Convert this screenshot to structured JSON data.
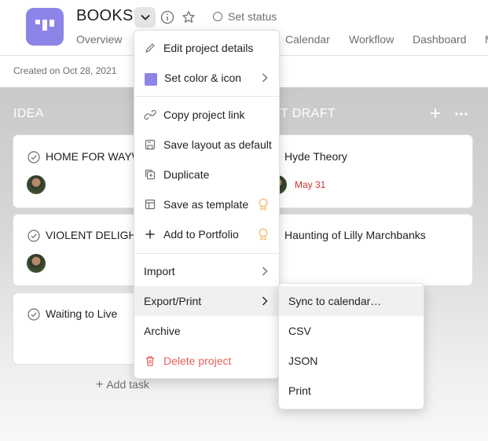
{
  "header": {
    "title": "BOOKS",
    "set_status": "Set status",
    "tabs": [
      "Overview",
      "Calendar",
      "Workflow",
      "Dashboard",
      "M"
    ],
    "created": "Created on Oct 28, 2021",
    "project_color": "#8d84e8"
  },
  "board": {
    "columns": [
      {
        "title": "IDEA"
      },
      {
        "title": "T DRAFT"
      }
    ],
    "cards": [
      {
        "title": "HOME FOR WAYW",
        "has_avatar": true
      },
      {
        "title": "VIOLENT DELIGH",
        "has_avatar": true
      },
      {
        "title": "Waiting to Live",
        "has_avatar": false
      },
      {
        "title": "Hyde Theory",
        "has_avatar": true,
        "due": "May 31"
      },
      {
        "title": "Haunting of Lilly Marchbanks",
        "has_avatar": false
      }
    ],
    "add_task": "Add task"
  },
  "menu": {
    "items": [
      {
        "label": "Edit project details",
        "icon": "pencil-icon"
      },
      {
        "label": "Set color & icon",
        "icon": "color-swatch-icon",
        "submenu": true
      },
      {
        "label": "Copy project link",
        "icon": "link-icon"
      },
      {
        "label": "Save layout as default",
        "icon": "save-icon"
      },
      {
        "label": "Duplicate",
        "icon": "duplicate-icon"
      },
      {
        "label": "Save as template",
        "icon": "template-icon",
        "premium": true
      },
      {
        "label": "Add to Portfolio",
        "icon": "plus-icon",
        "premium": true
      },
      {
        "label": "Import",
        "submenu": true
      },
      {
        "label": "Export/Print",
        "submenu": true,
        "active": true
      },
      {
        "label": "Archive"
      },
      {
        "label": "Delete project",
        "icon": "trash-icon",
        "danger": true
      }
    ]
  },
  "submenu": {
    "items": [
      "Sync to calendar…",
      "CSV",
      "JSON",
      "Print"
    ]
  },
  "colors": {
    "accent": "#8d84e8",
    "danger": "#e8615a",
    "due_red": "#c9372c",
    "premium_gold": "#f1bd6c"
  }
}
